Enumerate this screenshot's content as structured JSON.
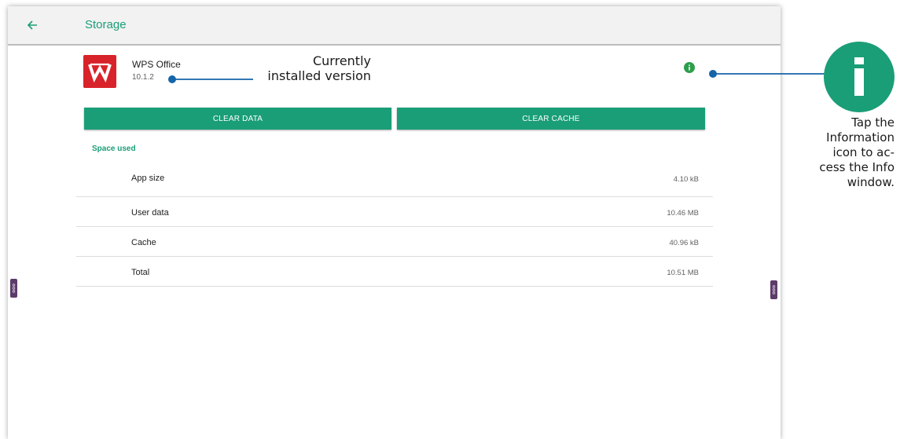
{
  "appbar": {
    "title": "Storage",
    "back_icon": "arrow-left-icon"
  },
  "app": {
    "name": "WPS Office",
    "version": "10.1.2",
    "icon": "wps-office-logo"
  },
  "info_icon": "info-icon",
  "buttons": {
    "clear_data": "CLEAR DATA",
    "clear_cache": "CLEAR CACHE"
  },
  "section_label": "Space used",
  "storage_rows": [
    {
      "label": "App size",
      "value": "4.10 kB"
    },
    {
      "label": "User data",
      "value": "10.46 MB"
    },
    {
      "label": "Cache",
      "value": "40.96 kB"
    },
    {
      "label": "Total",
      "value": "10.51 MB"
    }
  ],
  "callouts": {
    "version_line1": "Currently",
    "version_line2": "installed version",
    "info_line1": "Tap the",
    "info_line2": "Information",
    "info_line3": "icon to ac-",
    "info_line4": "cess the Info",
    "info_line5": "window."
  },
  "colors": {
    "accent": "#1a9e77",
    "app_icon_bg": "#d8232a",
    "handle": "#5c3b68",
    "callout_line": "#1565a8"
  }
}
